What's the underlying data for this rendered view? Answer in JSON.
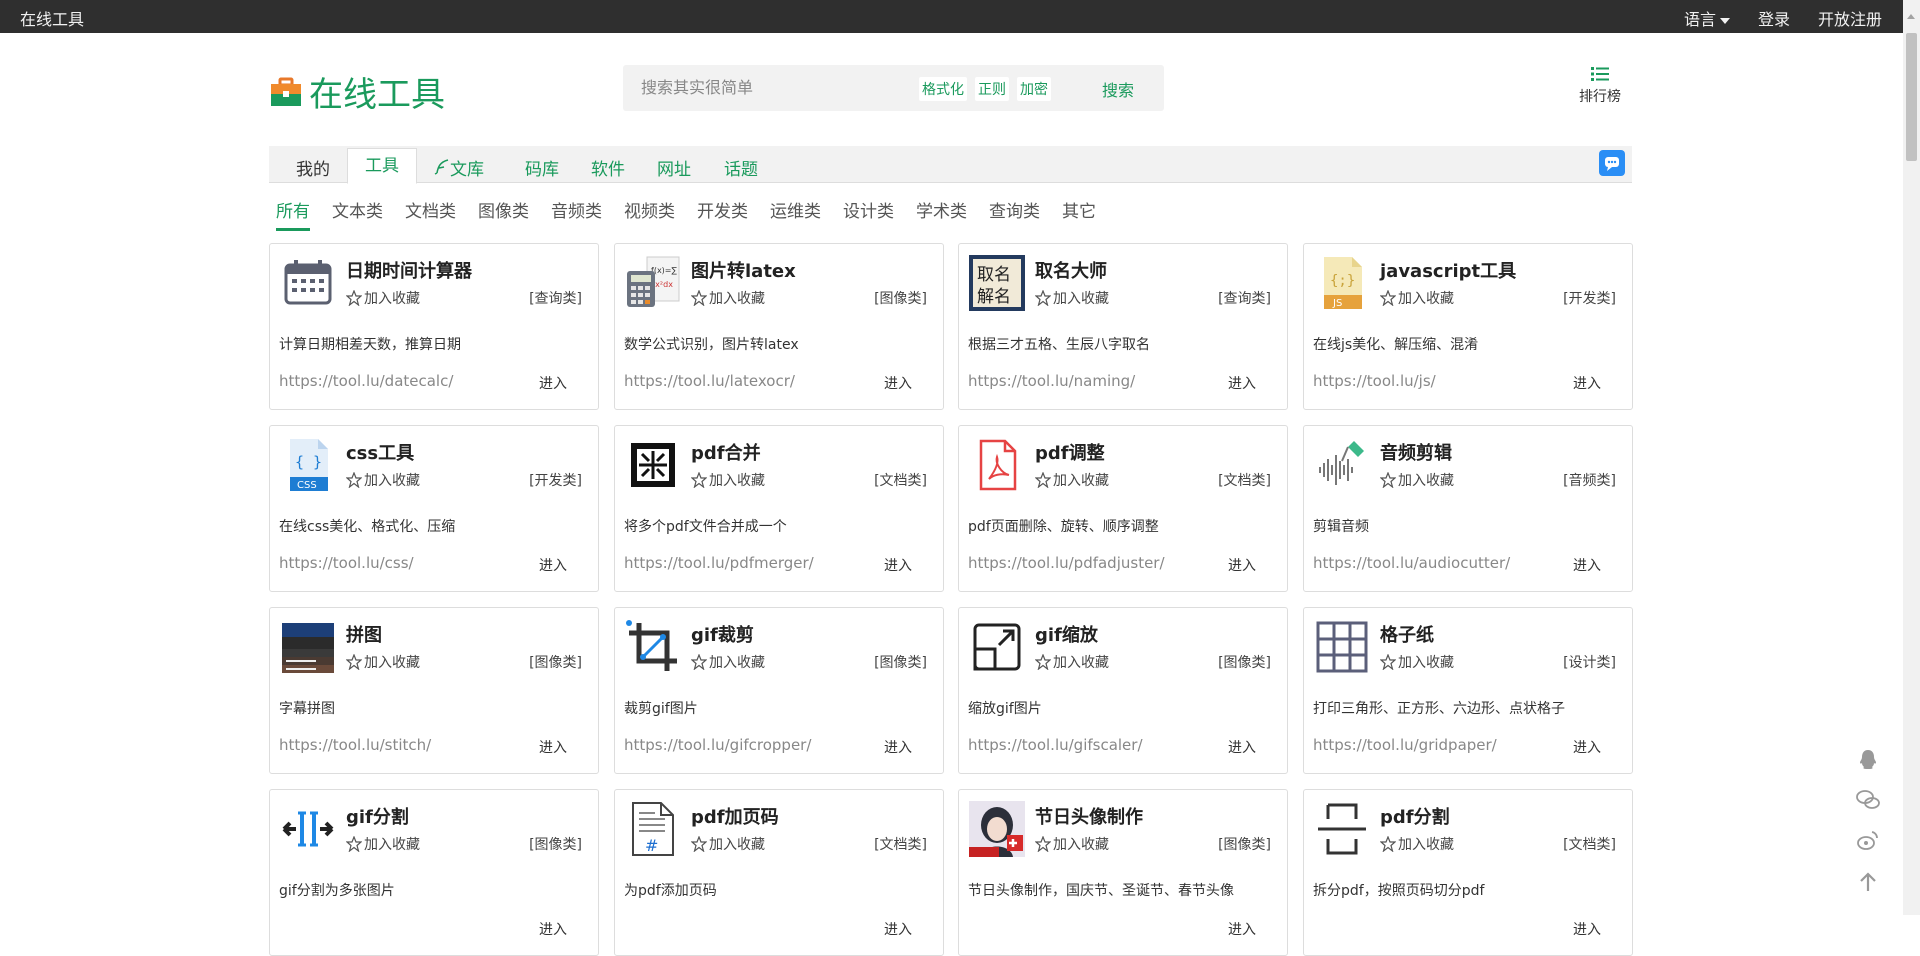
{
  "topbar": {
    "site_name": "在线工具",
    "language_label": "语言",
    "login_label": "登录",
    "register_label": "开放注册"
  },
  "header": {
    "logo_text": "在线工具",
    "search_placeholder": "搜索其实很简单",
    "search_tags": [
      "格式化",
      "正则",
      "加密"
    ],
    "search_button": "搜索",
    "rank_label": "排行榜"
  },
  "nav": {
    "tabs": [
      {
        "label": "我的"
      },
      {
        "label": "工具"
      },
      {
        "label": "文库"
      },
      {
        "label": "码库"
      },
      {
        "label": "软件"
      },
      {
        "label": "网址"
      },
      {
        "label": "话题"
      }
    ],
    "active_tab": "工具"
  },
  "categories": [
    "所有",
    "文本类",
    "文档类",
    "图像类",
    "音频类",
    "视频类",
    "开发类",
    "运维类",
    "设计类",
    "学术类",
    "查询类",
    "其它"
  ],
  "active_category": "所有",
  "fav_label": "加入收藏",
  "enter_label": "进入",
  "tools": [
    {
      "title": "日期时间计算器",
      "tag": "[查询类]",
      "desc": "计算日期相差天数，推算日期",
      "url": "https://tool.lu/datecalc/",
      "icon": "calendar-icon"
    },
    {
      "title": "图片转latex",
      "tag": "[图像类]",
      "desc": "数学公式识别，图片转latex",
      "url": "https://tool.lu/latexocr/",
      "icon": "calculator-formula-icon"
    },
    {
      "title": "取名大师",
      "tag": "[查询类]",
      "desc": "根据三才五格、生辰八字取名",
      "url": "https://tool.lu/naming/",
      "icon": "naming-icon"
    },
    {
      "title": "javascript工具",
      "tag": "[开发类]",
      "desc": "在线js美化、解压缩、混淆",
      "url": "https://tool.lu/js/",
      "icon": "js-file-icon"
    },
    {
      "title": "css工具",
      "tag": "[开发类]",
      "desc": "在线css美化、格式化、压缩",
      "url": "https://tool.lu/css/",
      "icon": "css-file-icon"
    },
    {
      "title": "pdf合并",
      "tag": "[文档类]",
      "desc": "将多个pdf文件合并成一个",
      "url": "https://tool.lu/pdfmerger/",
      "icon": "merge-icon"
    },
    {
      "title": "pdf调整",
      "tag": "[文档类]",
      "desc": "pdf页面删除、旋转、顺序调整",
      "url": "https://tool.lu/pdfadjuster/",
      "icon": "pdf-icon"
    },
    {
      "title": "音频剪辑",
      "tag": "[音频类]",
      "desc": "剪辑音频",
      "url": "https://tool.lu/audiocutter/",
      "icon": "audio-wave-icon"
    },
    {
      "title": "拼图",
      "tag": "[图像类]",
      "desc": "字幕拼图",
      "url": "https://tool.lu/stitch/",
      "icon": "stitch-photo-icon"
    },
    {
      "title": "gif裁剪",
      "tag": "[图像类]",
      "desc": "裁剪gif图片",
      "url": "https://tool.lu/gifcropper/",
      "icon": "crop-icon"
    },
    {
      "title": "gif缩放",
      "tag": "[图像类]",
      "desc": "缩放gif图片",
      "url": "https://tool.lu/gifscaler/",
      "icon": "scale-icon"
    },
    {
      "title": "格子纸",
      "tag": "[设计类]",
      "desc": "打印三角形、正方形、六边形、点状格子",
      "url": "https://tool.lu/gridpaper/",
      "icon": "grid-icon"
    },
    {
      "title": "gif分割",
      "tag": "[图像类]",
      "desc": "gif分割为多张图片",
      "url": "",
      "icon": "split-icon"
    },
    {
      "title": "pdf加页码",
      "tag": "[文档类]",
      "desc": "为pdf添加页码",
      "url": "",
      "icon": "page-number-icon"
    },
    {
      "title": "节日头像制作",
      "tag": "[图像类]",
      "desc": "节日头像制作，国庆节、圣诞节、春节头像",
      "url": "",
      "icon": "avatar-photo-icon"
    },
    {
      "title": "pdf分割",
      "tag": "[文档类]",
      "desc": "拆分pdf，按照页码切分pdf",
      "url": "",
      "icon": "pdf-split-icon"
    }
  ],
  "colors": {
    "brand": "#1a9a5c",
    "topbar": "#2f2f2f",
    "chat": "#2a8ef5"
  }
}
